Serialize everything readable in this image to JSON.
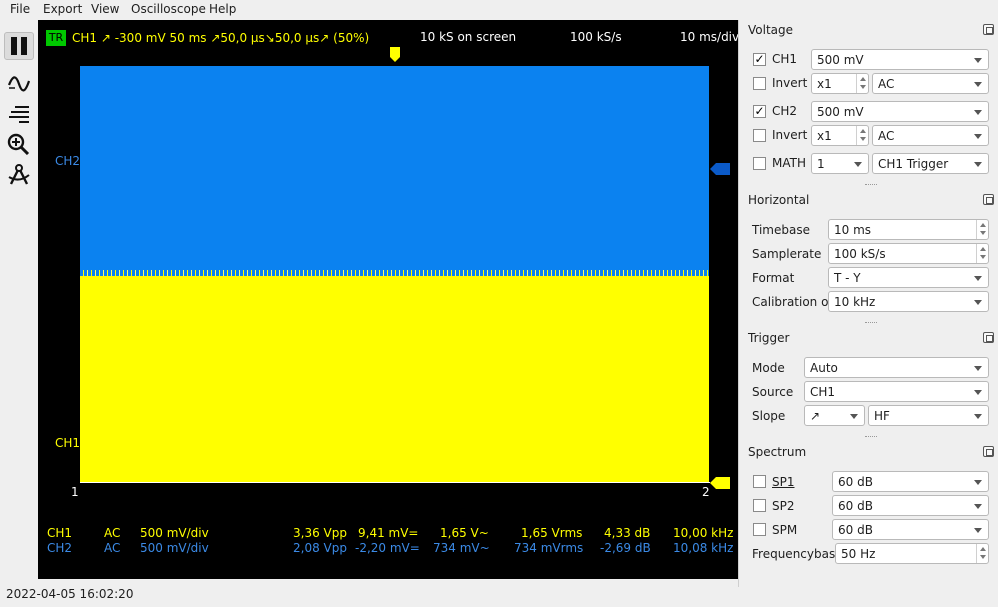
{
  "menu": {
    "file": "File",
    "export": "Export",
    "view": "View",
    "oscilloscope": "Oscilloscope",
    "help": "Help"
  },
  "toolbar": {
    "icons": [
      "pause-icon",
      "waveform-icon",
      "cursor-lines-icon",
      "zoom-icon",
      "measure-icon"
    ]
  },
  "scope": {
    "trigger_badge": "TR",
    "trigger_info": "CH1  ↗  -300 mV  50 ms  ↗50,0 µs↘50,0 µs↗ (50%)",
    "samples_on_screen": "10 kS on screen",
    "samplerate": "100 kS/s",
    "time_per_div": "10 ms/div",
    "ch2_marker": "CH2",
    "ch1_marker": "CH1",
    "left_marker": "1",
    "right_marker": "2",
    "colors": {
      "ch1": "#ffff00",
      "ch2": "#0b82f0",
      "background": "#000000",
      "trigger": "#00c800"
    },
    "measurements": [
      {
        "channel": "CH1",
        "coupling": "AC",
        "gain": "500 mV/div",
        "vpp": "3,36 Vpp",
        "dc": "9,41 mV=",
        "ac": "1,65 V~",
        "rms": "1,65 Vrms",
        "db": "4,33 dB",
        "freq": "10,00 kHz"
      },
      {
        "channel": "CH2",
        "coupling": "AC",
        "gain": "500 mV/div",
        "vpp": "2,08 Vpp",
        "dc": "-2,20 mV=",
        "ac": "734 mV~",
        "rms": "734 mVrms",
        "db": "-2,69 dB",
        "freq": "10,08 kHz"
      }
    ]
  },
  "status": {
    "timestamp": "2022-04-05 16:02:20"
  },
  "panel": {
    "voltage": {
      "title": "Voltage",
      "ch1_label": "CH1",
      "ch1_checked": true,
      "ch1_gain": "500 mV",
      "invert1_label": "Invert",
      "invert1_probe": "x1",
      "invert1_coupling": "AC",
      "ch2_label": "CH2",
      "ch2_checked": true,
      "ch2_gain": "500 mV",
      "invert2_label": "Invert",
      "invert2_probe": "x1",
      "invert2_coupling": "AC",
      "math_label": "MATH",
      "math_mode": "1",
      "math_source": "CH1 Trigger"
    },
    "horizontal": {
      "title": "Horizontal",
      "timebase_label": "Timebase",
      "timebase": "10 ms",
      "samplerate_label": "Samplerate",
      "samplerate": "100 kS/s",
      "format_label": "Format",
      "format": "T - Y",
      "calibration_label": "Calibration out",
      "calibration": "10 kHz"
    },
    "trigger": {
      "title": "Trigger",
      "mode_label": "Mode",
      "mode": "Auto",
      "source_label": "Source",
      "source": "CH1",
      "slope_label": "Slope",
      "slope": "↗",
      "filter": "HF"
    },
    "spectrum": {
      "title": "Spectrum",
      "sp1_label": "SP1",
      "sp1": "60 dB",
      "sp2_label": "SP2",
      "sp2": "60 dB",
      "spm_label": "SPM",
      "spm": "60 dB",
      "freqbase_label": "Frequencybase",
      "freqbase": "50 Hz"
    }
  }
}
